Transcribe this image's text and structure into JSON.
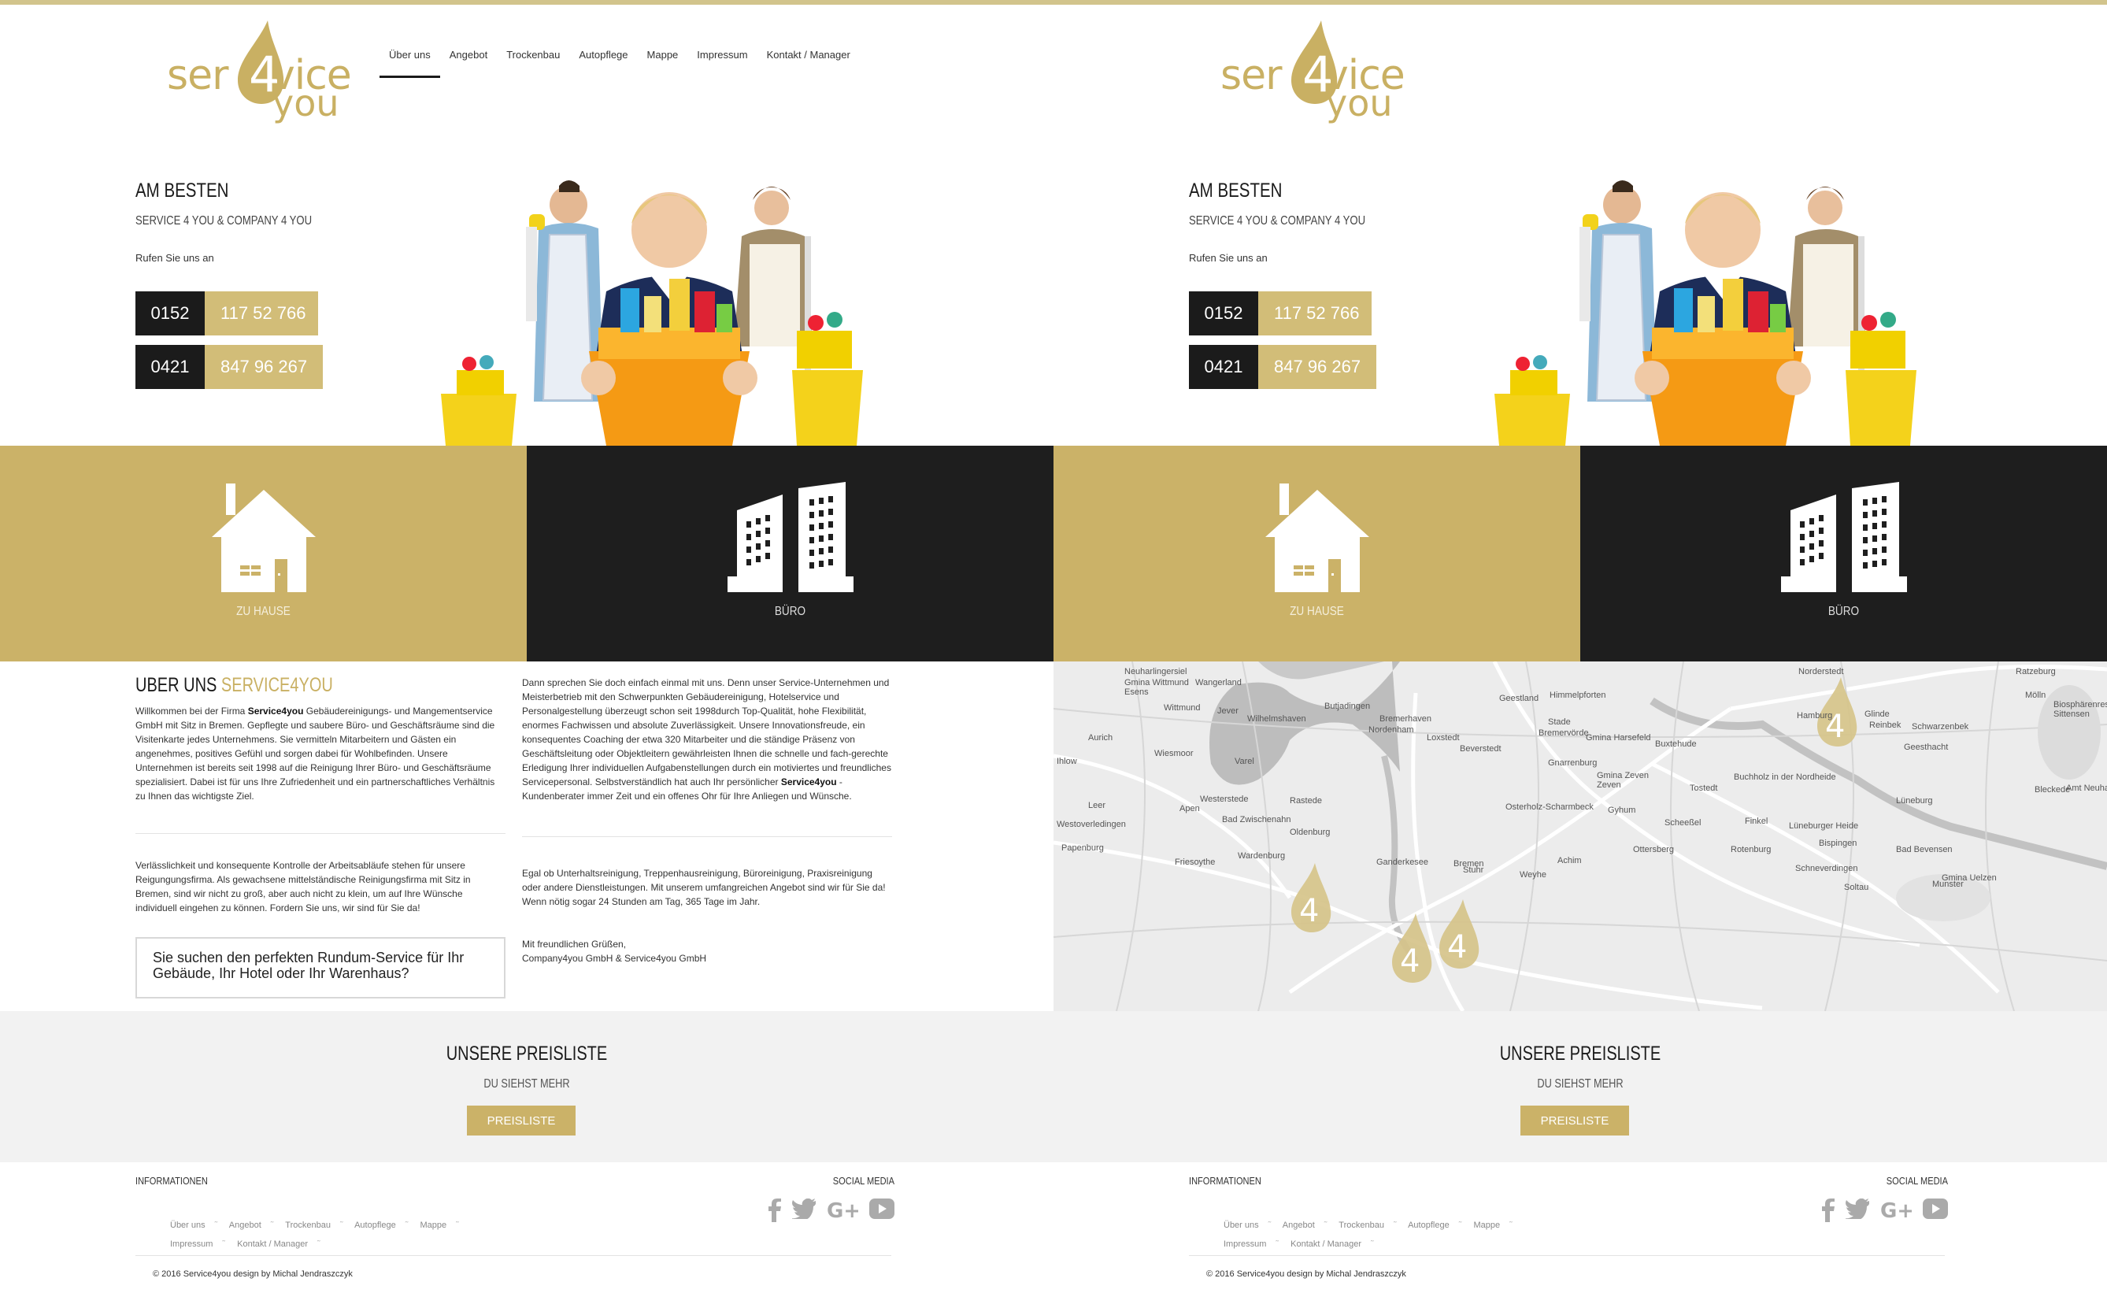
{
  "brand": {
    "logo_text": "ser4vice you",
    "accent": "#cbb268",
    "dark": "#1e1e1e"
  },
  "nav": [
    "Über uns",
    "Angebot",
    "Trockenbau",
    "Autopflege",
    "Mappe",
    "Impressum",
    "Kontakt / Manager"
  ],
  "hero": {
    "title": "AM BESTEN",
    "subtitle": "SERVICE 4 YOU & COMPANY 4 YOU",
    "call": "Rufen Sie uns an",
    "phones": [
      {
        "prefix": "0152",
        "number": "117 52 766"
      },
      {
        "prefix": "0421",
        "number": "847 96 267"
      }
    ]
  },
  "tiles": [
    {
      "label": "ZU HAUSE",
      "icon": "house-icon"
    },
    {
      "label": "BÜRO",
      "icon": "office-building-icon"
    }
  ],
  "about": {
    "title_a": "UBER UNS ",
    "title_b": "SERVICE4YOU",
    "p1_a": "Willkommen bei der Firma ",
    "p1_b": "Service4you",
    "p1_c": " Gebäudereinigungs- und Mangementservice GmbH mit Sitz in Bremen. Gepflegte und saubere Büro- und Geschäftsräume sind die Visitenkarte jedes Unternehmens. Sie vermitteln Mitarbeitern und Gästen ein angenehmes, positives Gefühl und sorgen dabei für Wohlbefinden. Unsere Unternehmen ist bereits seit 1998 auf die Reinigung Ihrer Büro- und Geschäftsräume spezialisiert. Dabei ist für uns Ihre Zufriedenheit und ein partnerschaftliches Verhältnis zu Ihnen das wichtigste Ziel.",
    "p2": "Verlässlichkeit und konsequente Kontrolle der Arbeitsabläufe stehen für unsere Reigungungsfirma. Als gewachsene mittelständische Reinigungsfirma mit Sitz in Bremen, sind wir nicht zu groß, aber auch nicht zu klein, um auf Ihre Wünsche individuell eingehen zu können. Fordern Sie uns, wir sind für Sie da!",
    "p3_a": "Dann sprechen Sie doch einfach einmal mit uns. Denn unser Service-Unternehmen und Meisterbetrieb mit den Schwerpunkten Gebäudereinigung, Hotelservice und Personalgestellung überzeugt schon seit 1998durch Top-Qualität, hohe Flexibilität, enormes Fachwissen und absolute Zuverlässigkeit. Unsere Innovationsfreude, ein konsequentes Coaching der etwa 320 Mitarbeiter und die ständige Präsenz von Geschäftsleitung oder Objektleitern gewährleisten Ihnen die schnelle und fach-gerechte Erledigung Ihrer individuellen Aufgabenstellungen durch ein motiviertes und freundliches Servicepersonal. Selbstverständlich hat auch Ihr persönlicher ",
    "p3_b": "Service4you",
    "p3_c": " -Kundenberater immer Zeit und ein offenes Ohr für Ihre Anliegen und Wünsche.",
    "p4": "Egal ob Unterhaltsreinigung, Treppenhausreinigung, Büroreinigung, Praxisreinigung oder andere Dienstleistungen. Mit unserem umfangreichen Angebot sind wir für Sie da! Wenn nötig sogar 24 Stunden am Tag, 365 Tage im Jahr.",
    "p5": "Mit freundlichen Grüßen,",
    "p6": "Company4you GmbH & Service4you GmbH",
    "quote": "Sie suchen den perfekten Rundum-Service für Ihr Gebäude, Ihr Hotel oder Ihr Warenhaus?"
  },
  "map": {
    "places": [
      "Neuharlingersiel",
      "Wangerland",
      "Gmina Wittmund",
      "Esens",
      "Wittmund",
      "Jever",
      "Wilhelmshaven",
      "Butjadingen",
      "Bremerhaven",
      "Nordenham",
      "Loxstedt",
      "Geestland",
      "Himmelpforten",
      "Stade",
      "Norderstedt",
      "Ratzeburg",
      "Hamburg",
      "Glinde",
      "Reinbek",
      "Schwarzenbek",
      "Mölln",
      "Aurich",
      "Ihlow",
      "Wiesmoor",
      "Varel",
      "Beverstedt",
      "Bremervörde",
      "Gnarrenburg",
      "Gmina Harsefeld",
      "Buxtehude",
      "Geesthacht",
      "Leer",
      "Westerstede",
      "Apen",
      "Rastede",
      "Bad Zwischenahn",
      "Oldenburg",
      "Osterholz-Scharmbeck",
      "Gmina Zeven",
      "Zeven",
      "Tostedt",
      "Buchholz in der Nordheide",
      "Lüneburg",
      "Westoverledingen",
      "Papenburg",
      "Friesoythe",
      "Wardenburg",
      "Ganderkesee",
      "Bremen",
      "Stuhr",
      "Weyhe",
      "Achim",
      "Ottersberg",
      "Scheeßel",
      "Rotenburg",
      "Schneverdingen",
      "Bispingen",
      "Bad Bevensen",
      "Soltau",
      "Munster",
      "Sittensen",
      "Gmina Uelzen",
      "Lüneburger Heide",
      "Finkel",
      "Gyhum",
      "Bleckede",
      "Amt Neuhaus",
      "Biosphärenreservat Schaalsee"
    ]
  },
  "pricing": {
    "title": "UNSERE PREISLISTE",
    "subtitle": "DU SIEHST MEHR",
    "button": "PREISLISTE"
  },
  "footer": {
    "info": "INFORMATIONEN",
    "social": "SOCIAL MEDIA",
    "links": [
      "Über uns",
      "Angebot",
      "Trockenbau",
      "Autopflege",
      "Mappe",
      "Impressum",
      "Kontakt / Manager"
    ],
    "copyright": "© 2016 Service4you design by Michal Jendraszczyk"
  }
}
